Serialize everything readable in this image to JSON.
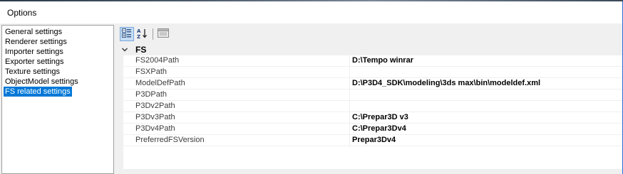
{
  "window": {
    "title": "Options"
  },
  "nav": {
    "items": [
      {
        "label": "General settings",
        "selected": false
      },
      {
        "label": "Renderer settings",
        "selected": false
      },
      {
        "label": "Importer settings",
        "selected": false
      },
      {
        "label": "Exporter settings",
        "selected": false
      },
      {
        "label": "Texture settings",
        "selected": false
      },
      {
        "label": "ObjectModel settings",
        "selected": false
      },
      {
        "label": "FS related settings",
        "selected": true
      }
    ]
  },
  "toolbar": {
    "categorized_icon": "categorized-view-icon",
    "alphabetical_icon": "sort-alphabetical-icon",
    "property_pages_icon": "property-pages-icon"
  },
  "grid": {
    "category": "FS",
    "properties": [
      {
        "name": "FS2004Path",
        "value": "D:\\Tempo winrar"
      },
      {
        "name": "FSXPath",
        "value": ""
      },
      {
        "name": "ModelDefPath",
        "value": "D:\\P3D4_SDK\\modeling\\3ds max\\bin\\modeldef.xml"
      },
      {
        "name": "P3DPath",
        "value": ""
      },
      {
        "name": "P3Dv2Path",
        "value": ""
      },
      {
        "name": "P3Dv3Path",
        "value": "C:\\Prepar3D v3"
      },
      {
        "name": "P3Dv4Path",
        "value": "C:\\Prepar3Dv4"
      },
      {
        "name": "PreferredFSVersion",
        "value": "Prepar3Dv4"
      }
    ]
  },
  "colors": {
    "selection": "#0078d7",
    "window_border": "#2a6fd6",
    "chrome": "#f0f0f0"
  }
}
